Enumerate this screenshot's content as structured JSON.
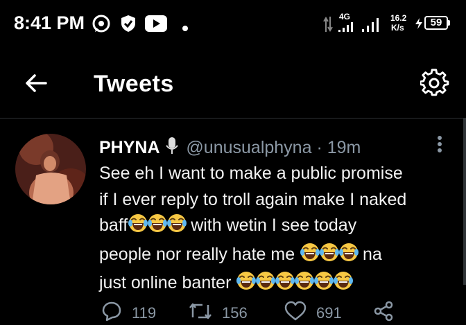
{
  "status_bar": {
    "time": "8:41 PM",
    "network_type": "4G",
    "speed_value": "16.2",
    "speed_unit": "K/s",
    "battery": "59",
    "icons": [
      "whatsapp-icon",
      "shield-check-icon",
      "youtube-icon",
      "dot-icon",
      "data-arrows-icon",
      "signal-icon",
      "signal-icon",
      "charging-icon",
      "battery-icon"
    ]
  },
  "header": {
    "title": "Tweets",
    "icons": [
      "back-arrow-icon",
      "settings-gear-icon"
    ]
  },
  "tweet": {
    "name": "PHYNA",
    "handle": "@unusualphyna",
    "time": "· 19m",
    "lines": [
      "See eh I want to make a public promise",
      "if I ever reply to troll again make I naked",
      "baff",
      " with wetin I see today",
      "people nor really hate me ",
      " na",
      "just online banter "
    ],
    "actions": {
      "replies": "119",
      "retweets": "156",
      "likes": "691"
    }
  },
  "colors": {
    "background": "#000000",
    "text": "#ffffff",
    "secondary": "#8b98a5",
    "divider": "#2f3336",
    "emoji_yellow": "#f7c844"
  }
}
